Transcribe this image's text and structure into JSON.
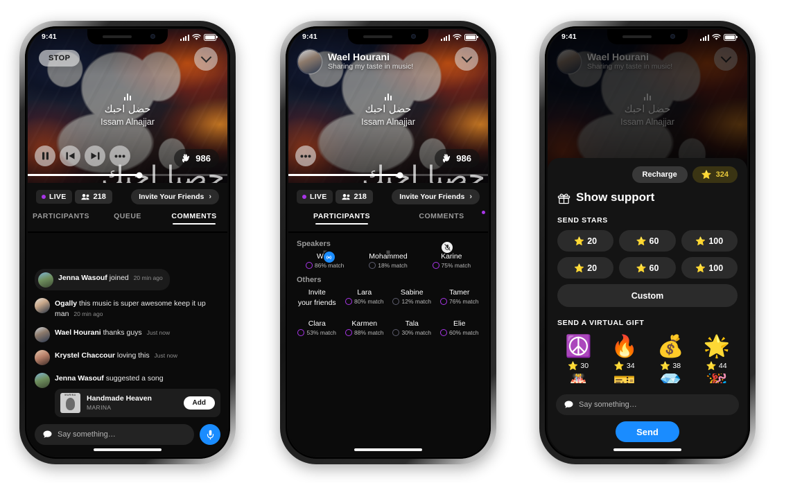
{
  "status_bar": {
    "time": "9:41"
  },
  "hero": {
    "track_title": "حضل احبك",
    "artist": "Issam Alnajjar",
    "arabic_overlay": "حصبا احبك",
    "stop_label": "STOP",
    "claps_count": "986",
    "host_name": "Wael Hourani",
    "host_subtitle": "Sharing my taste in music!"
  },
  "subbar": {
    "live_label": "LIVE",
    "viewers": "218",
    "invite_label": "Invite Your Friends",
    "chevron": "›"
  },
  "tabs": {
    "participants": "PARTICIPANTS",
    "queue": "QUEUE",
    "comments": "COMMENTS"
  },
  "comments": {
    "items": [
      {
        "author": "Jenna Wasouf",
        "text": "joined",
        "time": "20 min ago",
        "style": "joined",
        "avatar": "ph-jenna"
      },
      {
        "author": "Ogally",
        "text": "this music is super awesome keep it up man",
        "time": "20 min ago",
        "style": "normal",
        "avatar": "ph-ogally"
      },
      {
        "author": "Wael Hourani",
        "text": "thanks guys",
        "time": "Just now",
        "style": "normal",
        "avatar": "ph-wael"
      },
      {
        "author": "Krystel Chaccour",
        "text": "loving this",
        "time": "Just now",
        "style": "normal",
        "avatar": "ph-krystel"
      },
      {
        "author": "Jenna Wasouf",
        "text": "suggested a song",
        "time": "",
        "style": "normal",
        "avatar": "ph-jenna"
      }
    ],
    "song_card": {
      "title": "Handmade Heaven",
      "artist": "MARINA",
      "add_label": "Add",
      "cover_tag": "MARINA"
    },
    "composer": {
      "placeholder": "Say something…",
      "mic_icon": "microphone-icon"
    }
  },
  "participants": {
    "speakers_label": "Speakers",
    "others_label": "Others",
    "speakers": [
      {
        "name": "Wael",
        "match": "86% match",
        "avatar": "ph-wael",
        "badge": "live",
        "low": false
      },
      {
        "name": "Mohammed",
        "match": "18% match",
        "avatar": "ph-mohammed",
        "badge": "none",
        "low": true
      },
      {
        "name": "Karine",
        "match": "75% match",
        "avatar": "ph-karine",
        "badge": "mute",
        "low": false
      }
    ],
    "invite_cell": {
      "line1": "Invite",
      "line2": "your friends",
      "icon": "plus-icon"
    },
    "others": [
      {
        "name": "Lara",
        "match": "80% match",
        "avatar": "ph-lara",
        "low": false
      },
      {
        "name": "Sabine",
        "match": "12% match",
        "avatar": "ph-sabine",
        "low": true
      },
      {
        "name": "Tamer",
        "match": "76% match",
        "avatar": "ph-tamer",
        "low": false
      },
      {
        "name": "Clara",
        "match": "53% match",
        "avatar": "ph-clara",
        "low": false
      },
      {
        "name": "Karmen",
        "match": "88% match",
        "avatar": "ph-karmen",
        "low": false
      },
      {
        "name": "Tala",
        "match": "30% match",
        "avatar": "ph-tala",
        "low": true
      },
      {
        "name": "Elie",
        "match": "60% match",
        "avatar": "ph-elie",
        "low": false
      }
    ]
  },
  "support_sheet": {
    "recharge_label": "Recharge",
    "star_balance": "324",
    "title": "Show support",
    "gift_icon": "gift-icon",
    "send_stars_label": "SEND STARS",
    "star_options": [
      {
        "amount": "20"
      },
      {
        "amount": "60"
      },
      {
        "amount": "100"
      },
      {
        "amount": "20"
      },
      {
        "amount": "60"
      },
      {
        "amount": "100"
      }
    ],
    "custom_label": "Custom",
    "virtual_gift_label": "SEND A VIRTUAL GIFT",
    "gifts": [
      {
        "icon": "☮️",
        "name": "peace-icon",
        "price": "30"
      },
      {
        "icon": "🔥",
        "name": "fire-icon",
        "price": "34"
      },
      {
        "icon": "💰",
        "name": "coin-icon",
        "price": "38"
      },
      {
        "icon": "🌟",
        "name": "stars-icon",
        "price": "44"
      }
    ],
    "gifts_row2": [
      {
        "icon": "🎂",
        "name": "cake-icon"
      },
      {
        "icon": "🎫",
        "name": "ticket-icon"
      },
      {
        "icon": "💎",
        "name": "gem-icon"
      },
      {
        "icon": "🎉",
        "name": "party-icon"
      }
    ],
    "composer_placeholder": "Say something…",
    "send_label": "Send"
  },
  "colors": {
    "accent_purple": "#a836e8",
    "accent_blue": "#1a8cff",
    "star_yellow": "#e8c93a",
    "sheet_bg": "#141414"
  }
}
